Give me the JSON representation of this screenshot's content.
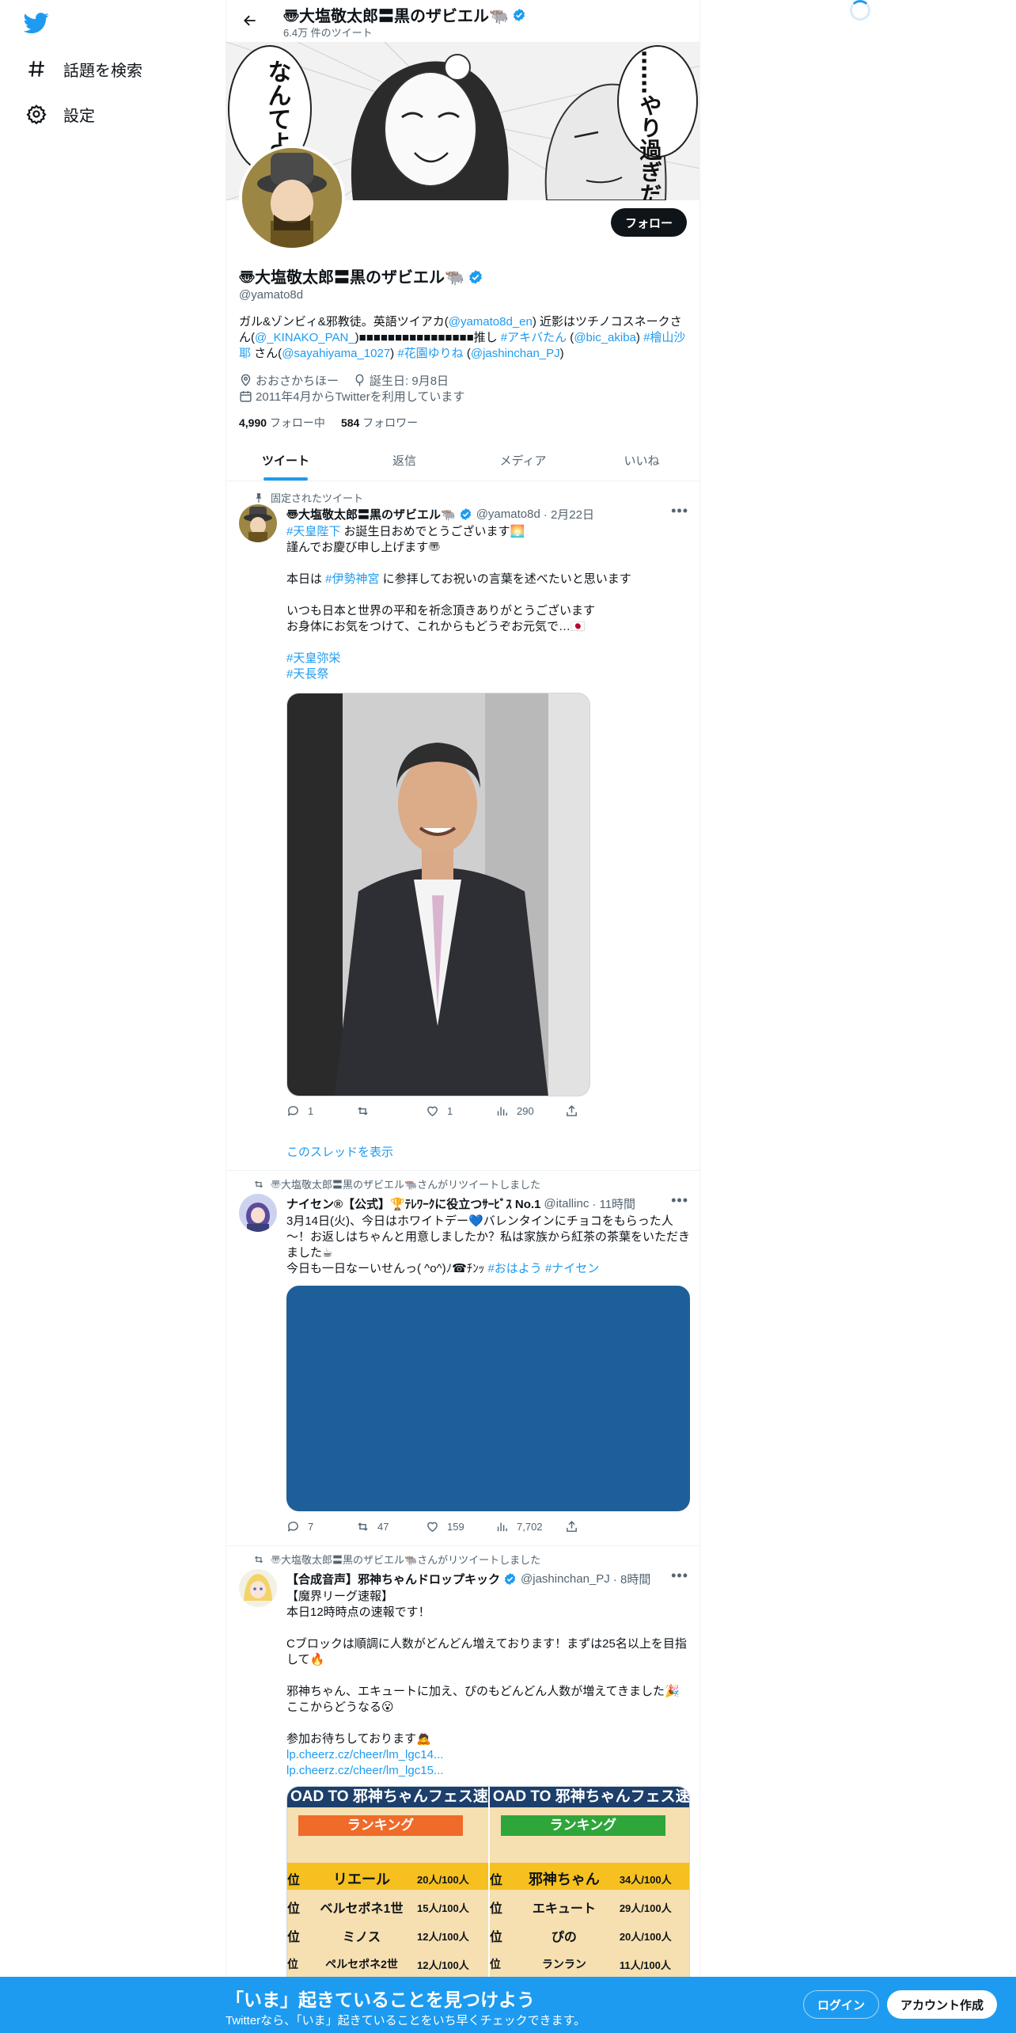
{
  "nav": {
    "search_label": "話題を検索",
    "settings_label": "設定"
  },
  "header": {
    "name": "〠大塩敬太郎〓黒のザビエル🐃",
    "tweet_count": "6.4万 件のツイート"
  },
  "banner": {
    "text_left": "なんてよ",
    "text_right": "……やり過ぎだ"
  },
  "profile": {
    "follow_label": "フォロー",
    "name": "〠大塩敬太郎〓黒のザビエル🐃",
    "handle": "@yamato8d",
    "bio_1": "ガル&ゾンビィ&邪教徒。英語ツイアカ(",
    "bio_link_1": "@yamato8d_en",
    "bio_2": ") 近影はツチノコスネークさん(",
    "bio_link_2": "@_KINAKO_PAN_",
    "bio_3": ")■■■■■■■■■■■■■■■■推し ",
    "bio_link_3": "#アキバたん",
    "bio_4": " (",
    "bio_link_4": "@bic_akiba",
    "bio_5": ") ",
    "bio_link_5": "#檜山沙耶",
    "bio_6": " さん(",
    "bio_link_6": "@sayahiyama_1027",
    "bio_7": ") ",
    "bio_link_7": "#花園ゆりね",
    "bio_8": " (",
    "bio_link_8": "@jashinchan_PJ",
    "bio_9": ")",
    "location": "おおさかちほー",
    "birthday": "誕生日: 9月8日",
    "joined": "2011年4月からTwitterを利用しています",
    "following_count": "4,990",
    "following_label": "フォロー中",
    "followers_count": "584",
    "followers_label": "フォロワー"
  },
  "tabs": [
    "ツイート",
    "返信",
    "メディア",
    "いいね"
  ],
  "tweets": [
    {
      "social": "固定されたツイート",
      "name": "〠大塩敬太郎〓黒のザビエル🐃",
      "handle": "@yamato8d",
      "time": "· 2月22日",
      "line1_link": "#天皇陛下",
      "line1_text": " お誕生日おめでとうございます🌅",
      "line2": "謹んでお慶び申し上げます〠",
      "line3_a": "本日は ",
      "line3_link": "#伊勢神宮",
      "line3_b": " に参拝してお祝いの言葉を述べたいと思います",
      "line4": "いつも日本と世界の平和を祈念頂きありがとうございます",
      "line5": "お身体にお気をつけて、これからもどうぞお元気で…🇯🇵",
      "tag1": "#天皇弥栄",
      "tag2": "#天長祭",
      "replies": "1",
      "retweets": "",
      "likes": "1",
      "views": "290",
      "show_thread": "このスレッドを表示"
    },
    {
      "social": "〠大塩敬太郎〓黒のザビエル🐃さんがリツイートしました",
      "name": "ナイセン®【公式】🏆ﾃﾚﾜｰｸに役立つｻｰﾋﾞｽ No.1",
      "handle": "@itallinc",
      "time": "· 11時間",
      "line1": "3月14日(火)、今日はホワイトデー💙バレンタインにチョコをもらった人～！お返しはちゃんと用意しましたか？私は家族から紅茶の茶葉をいただきました☕",
      "line2_a": "今日も一日なーいせんっ( ^o^)ﾉ☎ﾁﾝｯ ",
      "line2_link1": "#おはよう",
      "line2_link2": " #ナイセン",
      "replies": "7",
      "retweets": "47",
      "likes": "159",
      "views": "7,702"
    },
    {
      "social": "〠大塩敬太郎〓黒のザビエル🐃さんがリツイートしました",
      "name": "【合成音声】邪神ちゃんドロップキック",
      "handle": "@jashinchan_PJ",
      "time": "· 8時間",
      "line1": "【魔界リーグ速報】",
      "line2": "本日12時時点の速報です！",
      "line3": "Cブロックは順調に人数がどんどん増えております！まずは25名以上を目指して🔥",
      "line4": "邪神ちゃん、エキュートに加え、ぴのもどんどん人数が増えてきました🎉",
      "line5": "ここからどうなる😮",
      "line6": "参加お待ちしております🙇",
      "link1": "lp.cheerz.cz/cheer/lm_lgc14...",
      "link2": "lp.cheerz.cz/cheer/lm_lgc15...",
      "card_left": {
        "header": "OAD TO 邪神ちゃんフェス速",
        "ranking": "ランキング",
        "rows": [
          {
            "rank": "位",
            "name": "リエール",
            "count": "20人/100人"
          },
          {
            "rank": "位",
            "name": "ベルセポネ1世",
            "count": "15人/100人"
          },
          {
            "rank": "位",
            "name": "ミノス",
            "count": "12人/100人"
          },
          {
            "rank": "位",
            "name": "ペルセポネ2世",
            "count": "12人/100人"
          }
        ]
      },
      "card_right": {
        "header": "OAD TO 邪神ちゃんフェス速",
        "ranking": "ランキング",
        "rows": [
          {
            "rank": "位",
            "name": "邪神ちゃん",
            "count": "34人/100人"
          },
          {
            "rank": "位",
            "name": "エキュート",
            "count": "29人/100人"
          },
          {
            "rank": "位",
            "name": "ぴの",
            "count": "20人/100人"
          },
          {
            "rank": "位",
            "name": "ランラン",
            "count": "11人/100人"
          }
        ]
      }
    }
  ],
  "bottom_bar": {
    "title": "「いま」起きていることを見つけよう",
    "subtitle": "Twitterなら、「いま」起きていることをいち早くチェックできます。",
    "login": "ログイン",
    "signup": "アカウント作成"
  },
  "colors": {
    "accent": "#1d9bf0",
    "text": "#0f1419",
    "muted": "#536471",
    "media_blue": "#1f5f99"
  }
}
